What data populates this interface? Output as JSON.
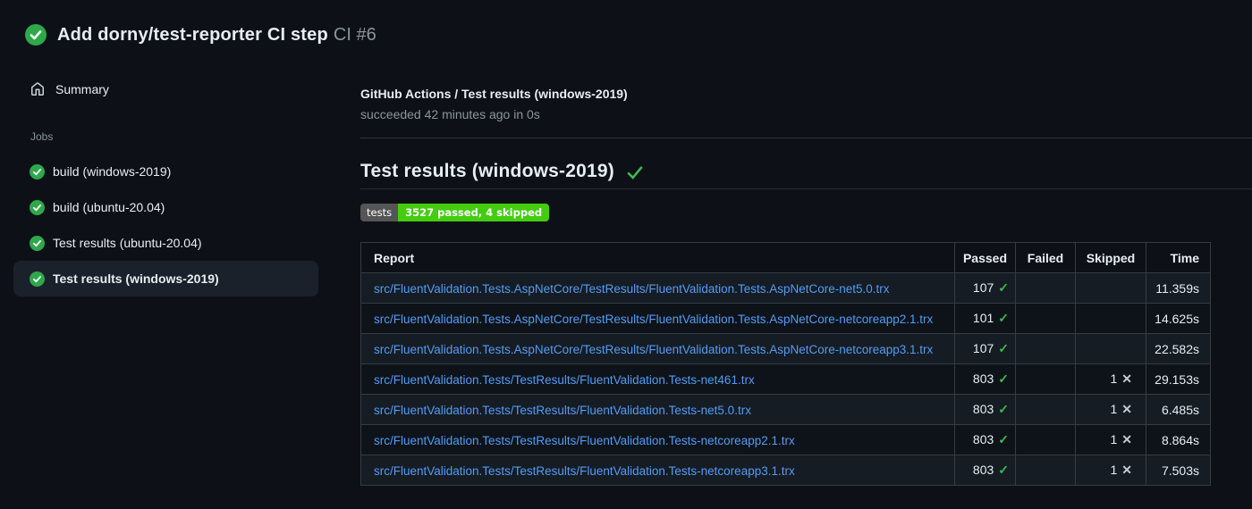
{
  "header": {
    "run_title": "Add dorny/test-reporter CI step",
    "run_number": "CI #6",
    "status": "success"
  },
  "sidebar": {
    "summary_label": "Summary",
    "jobs_section_label": "Jobs",
    "jobs": [
      {
        "label": "build (windows-2019)",
        "status": "success",
        "selected": false
      },
      {
        "label": "build (ubuntu-20.04)",
        "status": "success",
        "selected": false
      },
      {
        "label": "Test results (ubuntu-20.04)",
        "status": "success",
        "selected": false
      },
      {
        "label": "Test results (windows-2019)",
        "status": "success",
        "selected": true
      }
    ]
  },
  "main": {
    "check_title": "GitHub Actions / Test results (windows-2019)",
    "check_status_line": "succeeded 42 minutes ago in 0s",
    "heading": "Test results (windows-2019)",
    "heading_status": "success",
    "badge": {
      "label": "tests",
      "value": "3527 passed, 4 skipped",
      "label_bg": "#555555",
      "value_bg": "#44cc11"
    },
    "table": {
      "columns": [
        "Report",
        "Passed",
        "Failed",
        "Skipped",
        "Time"
      ],
      "rows": [
        {
          "report": "src/FluentValidation.Tests.AspNetCore/TestResults/FluentValidation.Tests.AspNetCore-net5.0.trx",
          "passed": "107",
          "failed": "",
          "skipped": "",
          "time": "11.359s"
        },
        {
          "report": "src/FluentValidation.Tests.AspNetCore/TestResults/FluentValidation.Tests.AspNetCore-netcoreapp2.1.trx",
          "passed": "101",
          "failed": "",
          "skipped": "",
          "time": "14.625s"
        },
        {
          "report": "src/FluentValidation.Tests.AspNetCore/TestResults/FluentValidation.Tests.AspNetCore-netcoreapp3.1.trx",
          "passed": "107",
          "failed": "",
          "skipped": "",
          "time": "22.582s"
        },
        {
          "report": "src/FluentValidation.Tests/TestResults/FluentValidation.Tests-net461.trx",
          "passed": "803",
          "failed": "",
          "skipped": "1",
          "time": "29.153s"
        },
        {
          "report": "src/FluentValidation.Tests/TestResults/FluentValidation.Tests-net5.0.trx",
          "passed": "803",
          "failed": "",
          "skipped": "1",
          "time": "6.485s"
        },
        {
          "report": "src/FluentValidation.Tests/TestResults/FluentValidation.Tests-netcoreapp2.1.trx",
          "passed": "803",
          "failed": "",
          "skipped": "1",
          "time": "8.864s"
        },
        {
          "report": "src/FluentValidation.Tests/TestResults/FluentValidation.Tests-netcoreapp3.1.trx",
          "passed": "803",
          "failed": "",
          "skipped": "1",
          "time": "7.503s"
        }
      ]
    }
  },
  "icons": {
    "pass_glyph": "✓",
    "skip_glyph": "✕"
  },
  "colors": {
    "success_fill": "#2ea84b",
    "success_stroke": "#3fb950",
    "link": "#539bf5",
    "background": "#0d1117"
  }
}
